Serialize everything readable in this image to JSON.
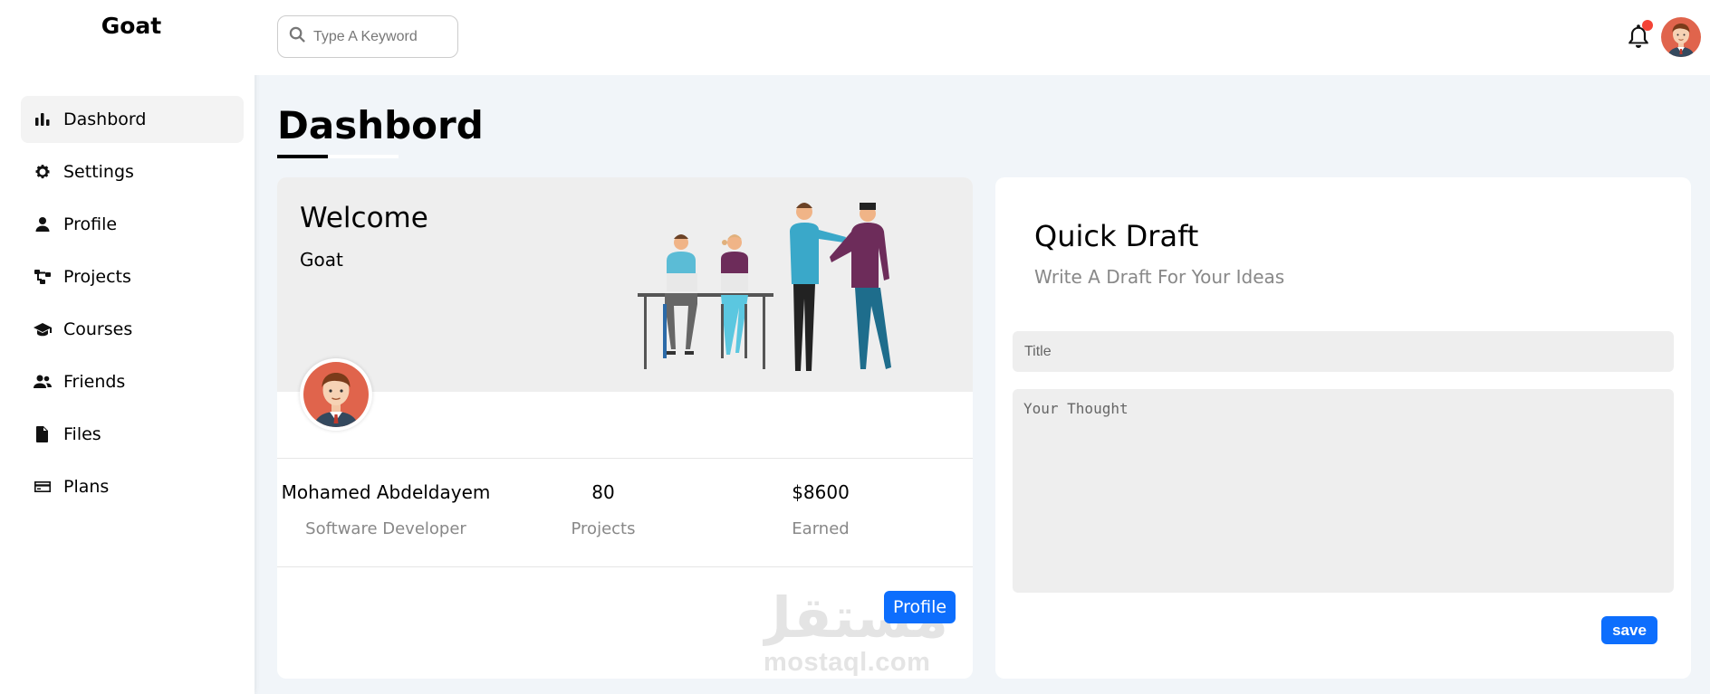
{
  "app": {
    "brand": "Goat"
  },
  "sidebar": {
    "items": [
      {
        "label": "Dashbord",
        "icon": "bar-chart-icon",
        "active": true
      },
      {
        "label": "Settings",
        "icon": "gear-icon"
      },
      {
        "label": "Profile",
        "icon": "user-icon"
      },
      {
        "label": "Projects",
        "icon": "diagram-project-icon"
      },
      {
        "label": "Courses",
        "icon": "graduation-cap-icon"
      },
      {
        "label": "Friends",
        "icon": "users-icon"
      },
      {
        "label": "Files",
        "icon": "file-icon"
      },
      {
        "label": "Plans",
        "icon": "credit-card-icon"
      }
    ]
  },
  "header": {
    "search_placeholder": "Type A Keyword",
    "notification_dot_color": "#f44336"
  },
  "page": {
    "title": "Dashbord"
  },
  "welcome": {
    "title": "Welcome",
    "subtitle": "Goat",
    "stats": [
      {
        "value": "Mohamed Abdeldayem",
        "label": "Software Developer"
      },
      {
        "value": "80",
        "label": "Projects"
      },
      {
        "value": "$8600",
        "label": "Earned"
      }
    ],
    "profile_button": "Profile",
    "watermark_ar": "مستقل",
    "watermark_en": "mostaql.com"
  },
  "draft": {
    "title": "Quick Draft",
    "subtitle": "Write A Draft For Your Ideas",
    "title_placeholder": "Title",
    "thought_placeholder": "Your Thought",
    "save_button": "save"
  },
  "colors": {
    "accent": "#0d6efd",
    "background": "#f1f5f9"
  }
}
